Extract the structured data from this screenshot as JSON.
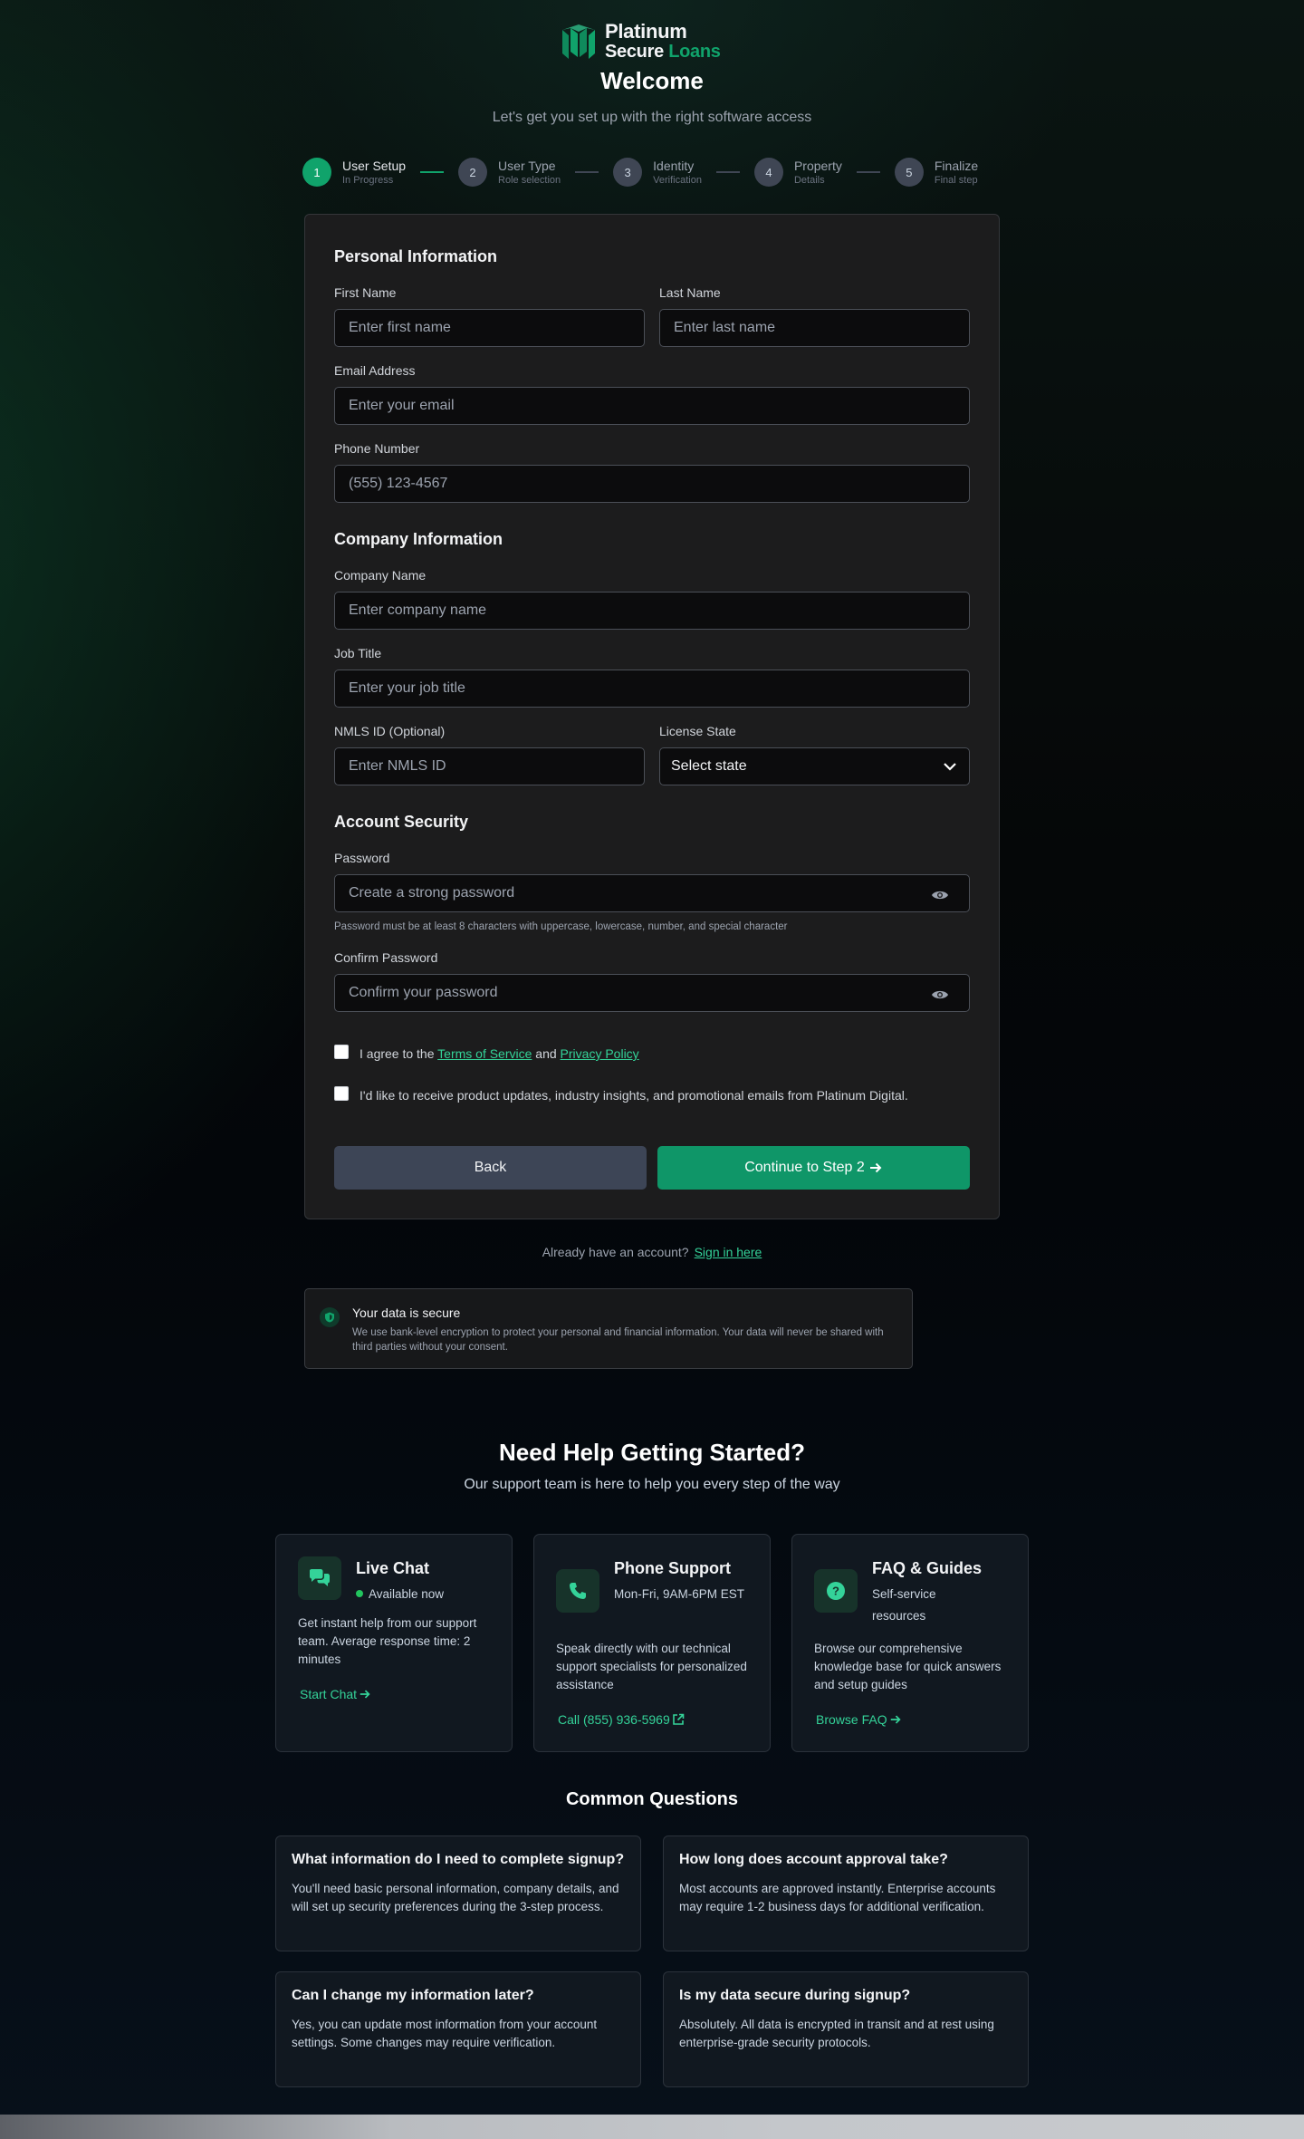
{
  "brand": {
    "line1": "Platinum",
    "line2_a": "Secure",
    "line2_b": "Loans",
    "accent_color": "#10a36b"
  },
  "header": {
    "title": "Welcome",
    "subtitle": "Let's get you set up with the right software access"
  },
  "steps": [
    {
      "num": "1",
      "title": "User Setup",
      "sub": "In Progress",
      "active": true
    },
    {
      "num": "2",
      "title": "User Type",
      "sub": "Role selection",
      "active": false
    },
    {
      "num": "3",
      "title": "Identity",
      "sub": "Verification",
      "active": false
    },
    {
      "num": "4",
      "title": "Property",
      "sub": "Details",
      "active": false
    },
    {
      "num": "5",
      "title": "Finalize",
      "sub": "Final step",
      "active": false
    }
  ],
  "form": {
    "personal_title": "Personal Information",
    "first_name_label": "First Name",
    "first_name_placeholder": "Enter first name",
    "last_name_label": "Last Name",
    "last_name_placeholder": "Enter last name",
    "email_label": "Email Address",
    "email_placeholder": "Enter your email",
    "phone_label": "Phone Number",
    "phone_placeholder": "(555) 123-4567",
    "company_title": "Company Information",
    "company_label": "Company Name",
    "company_placeholder": "Enter company name",
    "job_label": "Job Title",
    "job_placeholder": "Enter your job title",
    "nmls_label": "NMLS ID (Optional)",
    "nmls_placeholder": "Enter NMLS ID",
    "state_label": "License State",
    "state_value": "Select state",
    "security_title": "Account Security",
    "password_label": "Password",
    "password_placeholder": "Create a strong password",
    "password_hint": "Password must be at least 8 characters with uppercase, lowercase, number, and special character",
    "confirm_label": "Confirm Password",
    "confirm_placeholder": "Confirm your password",
    "agree_prefix": "I agree to the",
    "terms_link": "Terms of Service",
    "agree_and": "and",
    "privacy_link": "Privacy Policy",
    "marketing_text": "I'd like to receive product updates, industry insights, and promotional emails from Platinum Digital.",
    "back_label": "Back",
    "continue_label": "Continue to Step 2"
  },
  "signin": {
    "text": "Already have an account?",
    "link": "Sign in here"
  },
  "secure": {
    "title": "Your data is secure",
    "text": "We use bank-level encryption to protect your personal and financial information. Your data will never be shared with third parties without your consent."
  },
  "help": {
    "title": "Need Help Getting Started?",
    "subtitle": "Our support team is here to help you every step of the way",
    "cards": [
      {
        "title": "Live Chat",
        "meta": "Available now",
        "desc": "Get instant help from our support team. Average response time: 2 minutes",
        "link": "Start Chat",
        "icon": "chat-icon"
      },
      {
        "title": "Phone Support",
        "meta": "Mon-Fri, 9AM-6PM EST",
        "desc": "Speak directly with our technical support specialists for personalized assistance",
        "link": "Call (855) 936-5969",
        "icon": "phone-icon"
      },
      {
        "title": "FAQ & Guides",
        "meta": "Self-service resources",
        "desc": "Browse our comprehensive knowledge base for quick answers and setup guides",
        "link": "Browse FAQ",
        "icon": "question-icon"
      }
    ]
  },
  "faq": {
    "title": "Common Questions",
    "items": [
      {
        "q": "What information do I need to complete signup?",
        "a": "You'll need basic personal information, company details, and will set up security preferences during the 3-step process."
      },
      {
        "q": "How long does account approval take?",
        "a": "Most accounts are approved instantly. Enterprise accounts may require 1-2 business days for additional verification."
      },
      {
        "q": "Can I change my information later?",
        "a": "Yes, you can update most information from your account settings. Some changes may require verification."
      },
      {
        "q": "Is my data secure during signup?",
        "a": "Absolutely. All data is encrypted in transit and at rest using enterprise-grade security protocols."
      }
    ]
  }
}
